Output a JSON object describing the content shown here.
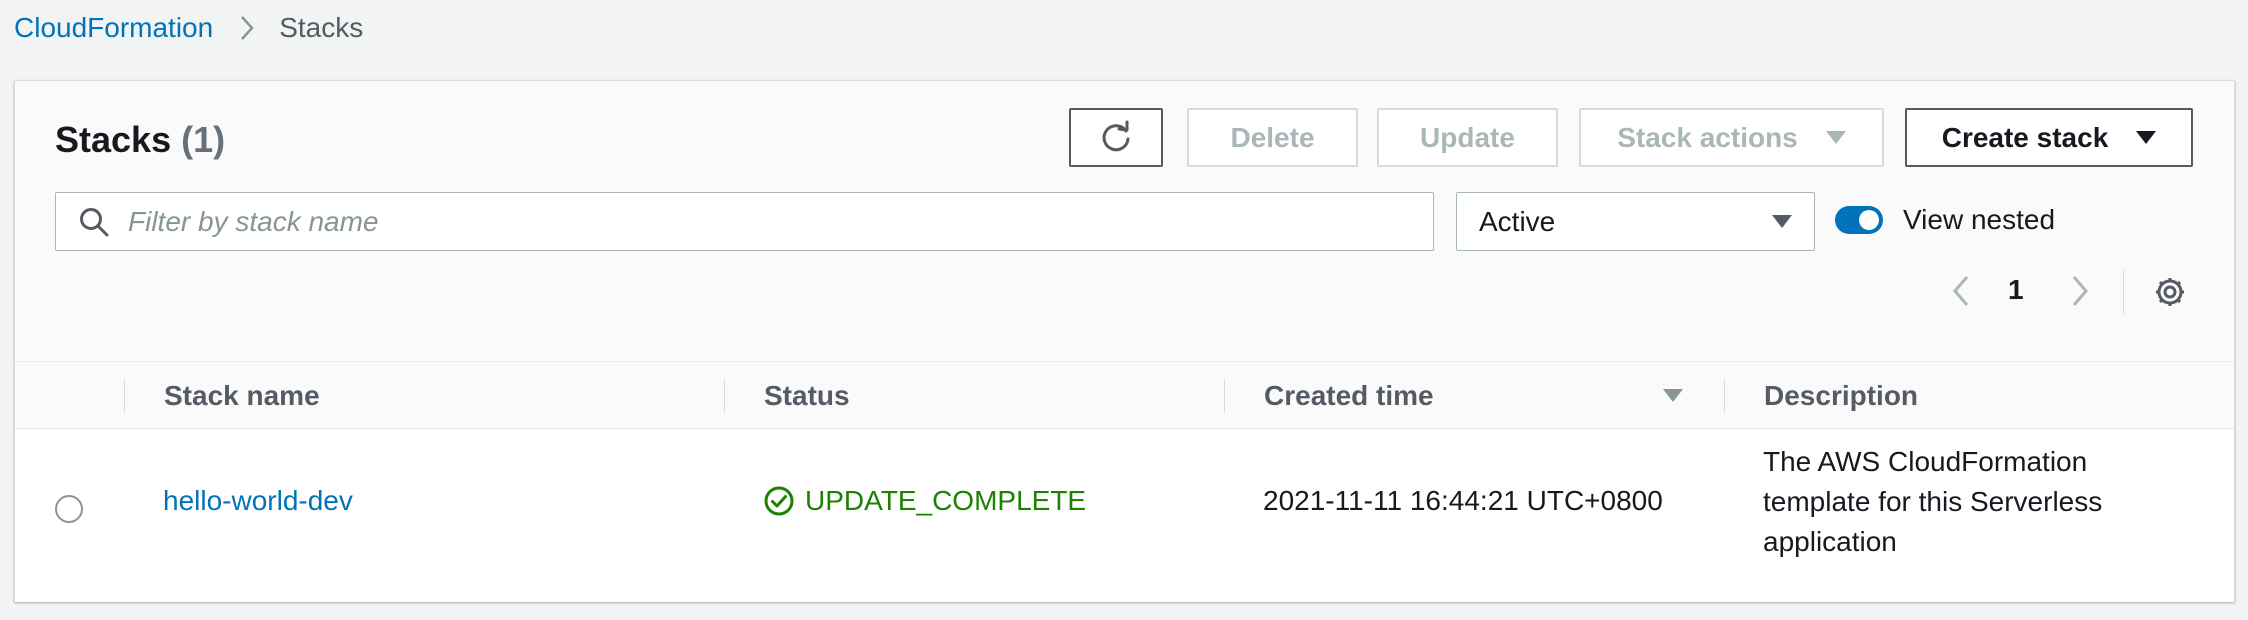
{
  "breadcrumb": {
    "root": "CloudFormation",
    "current": "Stacks"
  },
  "panel": {
    "title": "Stacks",
    "count": "(1)"
  },
  "toolbar": {
    "delete_label": "Delete",
    "update_label": "Update",
    "stack_actions_label": "Stack actions",
    "create_stack_label": "Create stack"
  },
  "filter": {
    "placeholder": "Filter by stack name",
    "value": ""
  },
  "status_filter": {
    "selected": "Active"
  },
  "view_nested": {
    "label": "View nested",
    "enabled": true
  },
  "pagination": {
    "current_page": "1"
  },
  "table": {
    "columns": [
      "Stack name",
      "Status",
      "Created time",
      "Description"
    ],
    "sort_column": "Created time",
    "sort_direction": "descending",
    "rows": [
      {
        "stack_name": "hello-world-dev",
        "status": "UPDATE_COMPLETE",
        "created_time": "2021-11-11 16:44:21 UTC+0800",
        "description_lines": [
          "The AWS CloudFormation",
          "template for this Serverless",
          "application"
        ]
      }
    ]
  },
  "colors": {
    "link": "#0073bb",
    "success": "#1d8102",
    "toggle_on": "#0073bb"
  },
  "icons": [
    "chevron-right-icon",
    "refresh-icon",
    "caret-down-icon",
    "search-icon",
    "chevron-left-icon",
    "gear-icon",
    "check-circle-icon"
  ]
}
